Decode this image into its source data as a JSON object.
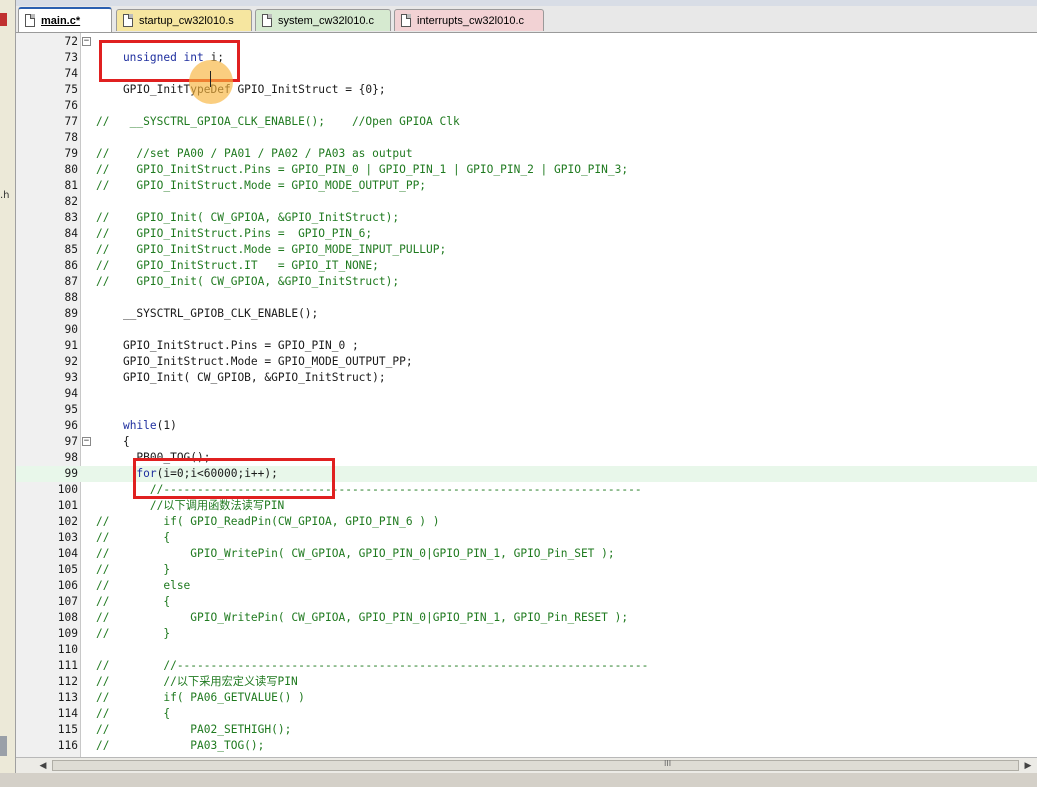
{
  "tabs": [
    {
      "label": "main.c*",
      "active": true
    },
    {
      "label": "startup_cw32l010.s",
      "active": false
    },
    {
      "label": "system_cw32l010.c",
      "active": false
    },
    {
      "label": "interrupts_cw32l010.c",
      "active": false
    }
  ],
  "code_lines": [
    {
      "n": "72",
      "fold": "−",
      "parts": []
    },
    {
      "n": "73",
      "parts": [
        [
          "kw",
          "    unsigned int "
        ],
        [
          "",
          "i;"
        ]
      ]
    },
    {
      "n": "74",
      "parts": []
    },
    {
      "n": "75",
      "parts": [
        [
          "",
          "    GPIO_InitTypeDef GPIO_InitStruct = {0};"
        ]
      ]
    },
    {
      "n": "76",
      "parts": []
    },
    {
      "n": "77",
      "parts": [
        [
          "cm",
          "//   __SYSCTRL_GPIOA_CLK_ENABLE();    //Open GPIOA Clk"
        ]
      ]
    },
    {
      "n": "78",
      "parts": []
    },
    {
      "n": "79",
      "parts": [
        [
          "cm",
          "//    //set PA00 / PA01 / PA02 / PA03 as output"
        ]
      ]
    },
    {
      "n": "80",
      "parts": [
        [
          "cm",
          "//    GPIO_InitStruct.Pins = GPIO_PIN_0 | GPIO_PIN_1 | GPIO_PIN_2 | GPIO_PIN_3;"
        ]
      ]
    },
    {
      "n": "81",
      "parts": [
        [
          "cm",
          "//    GPIO_InitStruct.Mode = GPIO_MODE_OUTPUT_PP;"
        ]
      ]
    },
    {
      "n": "82",
      "parts": []
    },
    {
      "n": "83",
      "parts": [
        [
          "cm",
          "//    GPIO_Init( CW_GPIOA, &GPIO_InitStruct);"
        ]
      ]
    },
    {
      "n": "84",
      "parts": [
        [
          "cm",
          "//    GPIO_InitStruct.Pins =  GPIO_PIN_6;"
        ]
      ]
    },
    {
      "n": "85",
      "parts": [
        [
          "cm",
          "//    GPIO_InitStruct.Mode = GPIO_MODE_INPUT_PULLUP;"
        ]
      ]
    },
    {
      "n": "86",
      "parts": [
        [
          "cm",
          "//    GPIO_InitStruct.IT   = GPIO_IT_NONE;"
        ]
      ]
    },
    {
      "n": "87",
      "parts": [
        [
          "cm",
          "//    GPIO_Init( CW_GPIOA, &GPIO_InitStruct);"
        ]
      ]
    },
    {
      "n": "88",
      "parts": []
    },
    {
      "n": "89",
      "parts": [
        [
          "",
          "    __SYSCTRL_GPIOB_CLK_ENABLE();"
        ]
      ]
    },
    {
      "n": "90",
      "parts": []
    },
    {
      "n": "91",
      "parts": [
        [
          "",
          "    GPIO_InitStruct.Pins = GPIO_PIN_0 ;"
        ]
      ]
    },
    {
      "n": "92",
      "parts": [
        [
          "",
          "    GPIO_InitStruct.Mode = GPIO_MODE_OUTPUT_PP;"
        ]
      ]
    },
    {
      "n": "93",
      "parts": [
        [
          "",
          "    GPIO_Init( CW_GPIOB, &GPIO_InitStruct);"
        ]
      ]
    },
    {
      "n": "94",
      "parts": []
    },
    {
      "n": "95",
      "parts": []
    },
    {
      "n": "96",
      "parts": [
        [
          "",
          "    "
        ],
        [
          "kw",
          "while"
        ],
        [
          "",
          "(1)"
        ]
      ]
    },
    {
      "n": "97",
      "fold": "−",
      "parts": [
        [
          "",
          "    {"
        ]
      ]
    },
    {
      "n": "98",
      "parts": [
        [
          "",
          "      PB00_TOG();"
        ]
      ]
    },
    {
      "n": "99",
      "hl": true,
      "parts": [
        [
          "",
          "      "
        ],
        [
          "kw",
          "for"
        ],
        [
          "",
          "(i=0;i<60000;i++);"
        ]
      ]
    },
    {
      "n": "100",
      "parts": [
        [
          "cm",
          "        //-----------------------------------------------------------------------"
        ]
      ]
    },
    {
      "n": "101",
      "parts": [
        [
          "cm",
          "        //以下调用函数法读写PIN"
        ]
      ]
    },
    {
      "n": "102",
      "parts": [
        [
          "cm",
          "//        if( GPIO_ReadPin(CW_GPIOA, GPIO_PIN_6 ) )"
        ]
      ]
    },
    {
      "n": "103",
      "parts": [
        [
          "cm",
          "//        {"
        ]
      ]
    },
    {
      "n": "104",
      "parts": [
        [
          "cm",
          "//            GPIO_WritePin( CW_GPIOA, GPIO_PIN_0|GPIO_PIN_1, GPIO_Pin_SET );"
        ]
      ]
    },
    {
      "n": "105",
      "parts": [
        [
          "cm",
          "//        }"
        ]
      ]
    },
    {
      "n": "106",
      "parts": [
        [
          "cm",
          "//        else"
        ]
      ]
    },
    {
      "n": "107",
      "parts": [
        [
          "cm",
          "//        {"
        ]
      ]
    },
    {
      "n": "108",
      "parts": [
        [
          "cm",
          "//            GPIO_WritePin( CW_GPIOA, GPIO_PIN_0|GPIO_PIN_1, GPIO_Pin_RESET );"
        ]
      ]
    },
    {
      "n": "109",
      "parts": [
        [
          "cm",
          "//        }"
        ]
      ]
    },
    {
      "n": "110",
      "parts": []
    },
    {
      "n": "111",
      "parts": [
        [
          "cm",
          "//        //----------------------------------------------------------------------"
        ]
      ]
    },
    {
      "n": "112",
      "parts": [
        [
          "cm",
          "//        //以下采用宏定义读写PIN"
        ]
      ]
    },
    {
      "n": "113",
      "parts": [
        [
          "cm",
          "//        if( PA06_GETVALUE() )"
        ]
      ]
    },
    {
      "n": "114",
      "parts": [
        [
          "cm",
          "//        {"
        ]
      ]
    },
    {
      "n": "115",
      "parts": [
        [
          "cm",
          "//            PA02_SETHIGH();"
        ]
      ]
    },
    {
      "n": "116",
      "parts": [
        [
          "cm",
          "//            PA03_TOG();"
        ]
      ]
    }
  ],
  "scrollbar": {
    "grip": "III"
  },
  "colors": {
    "annotation": "#e02020",
    "highlight_line": "#e8f7ea",
    "comment": "#1f7a1f",
    "keyword": "#1f2f9f"
  }
}
